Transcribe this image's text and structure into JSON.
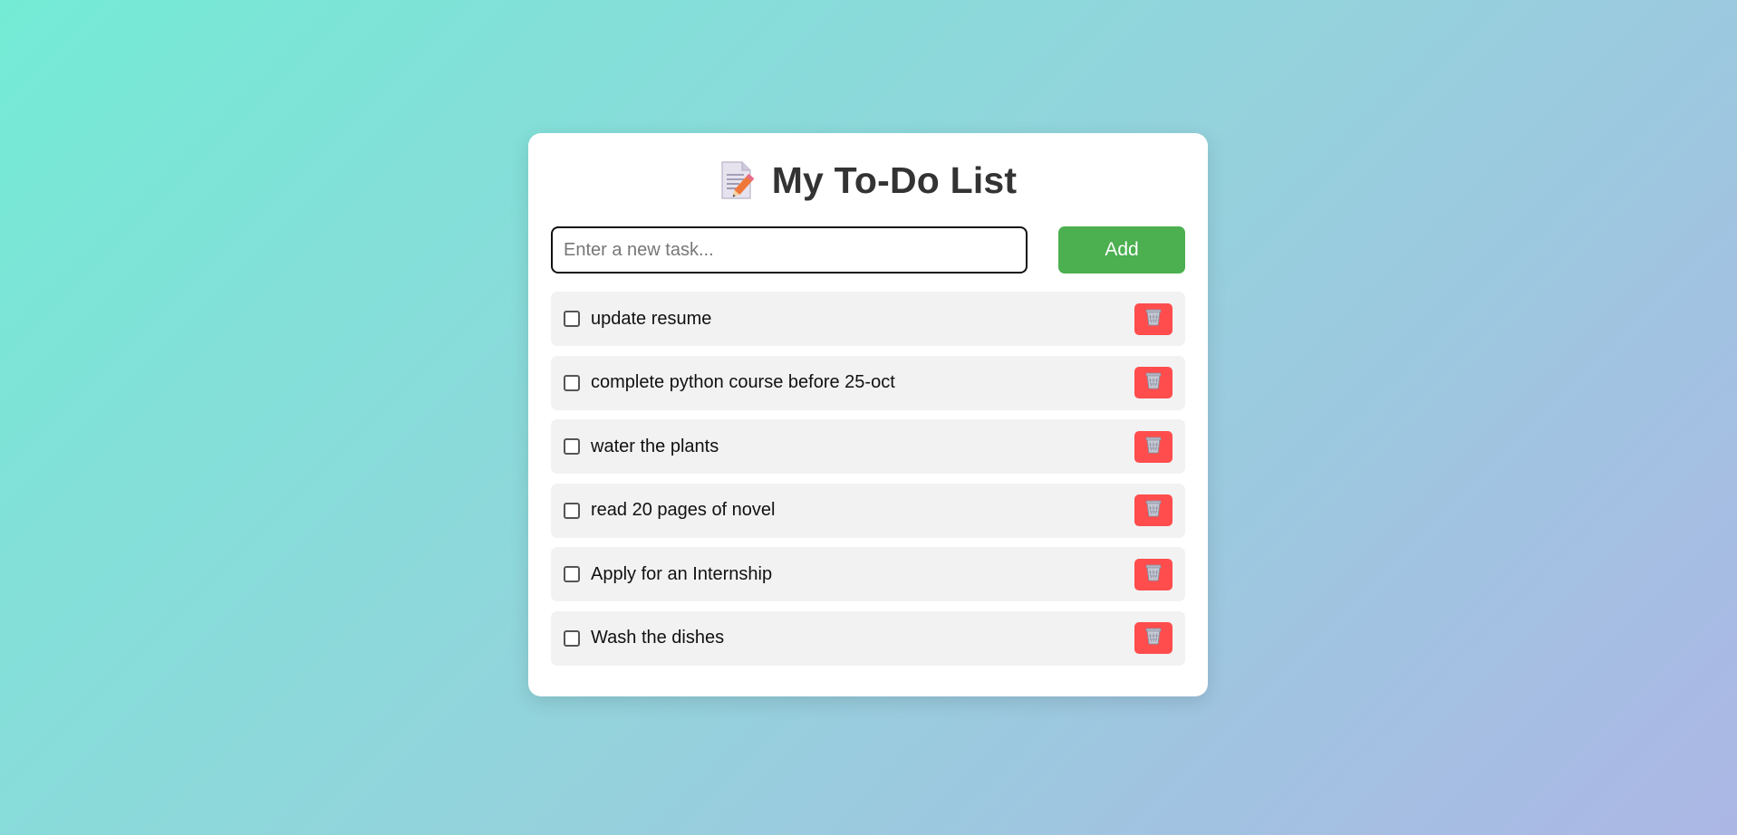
{
  "header": {
    "title": "My To-Do List",
    "icon": "memo-pencil-icon"
  },
  "input": {
    "placeholder": "Enter a new task...",
    "value": ""
  },
  "add_button": {
    "label": "Add",
    "color": "#4caf50"
  },
  "tasks": [
    {
      "text": "update resume",
      "done": false
    },
    {
      "text": "complete python course before 25-oct",
      "done": false
    },
    {
      "text": "water the plants",
      "done": false
    },
    {
      "text": "read 20 pages of novel",
      "done": false
    },
    {
      "text": "Apply for an Internship",
      "done": false
    },
    {
      "text": "Wash the dishes",
      "done": false
    }
  ],
  "delete_icon": "wastebasket-icon",
  "colors": {
    "accent": "#4caf50",
    "delete": "#ff4d4d",
    "background_start": "#74ebd5",
    "background_end": "#acb6e5"
  }
}
